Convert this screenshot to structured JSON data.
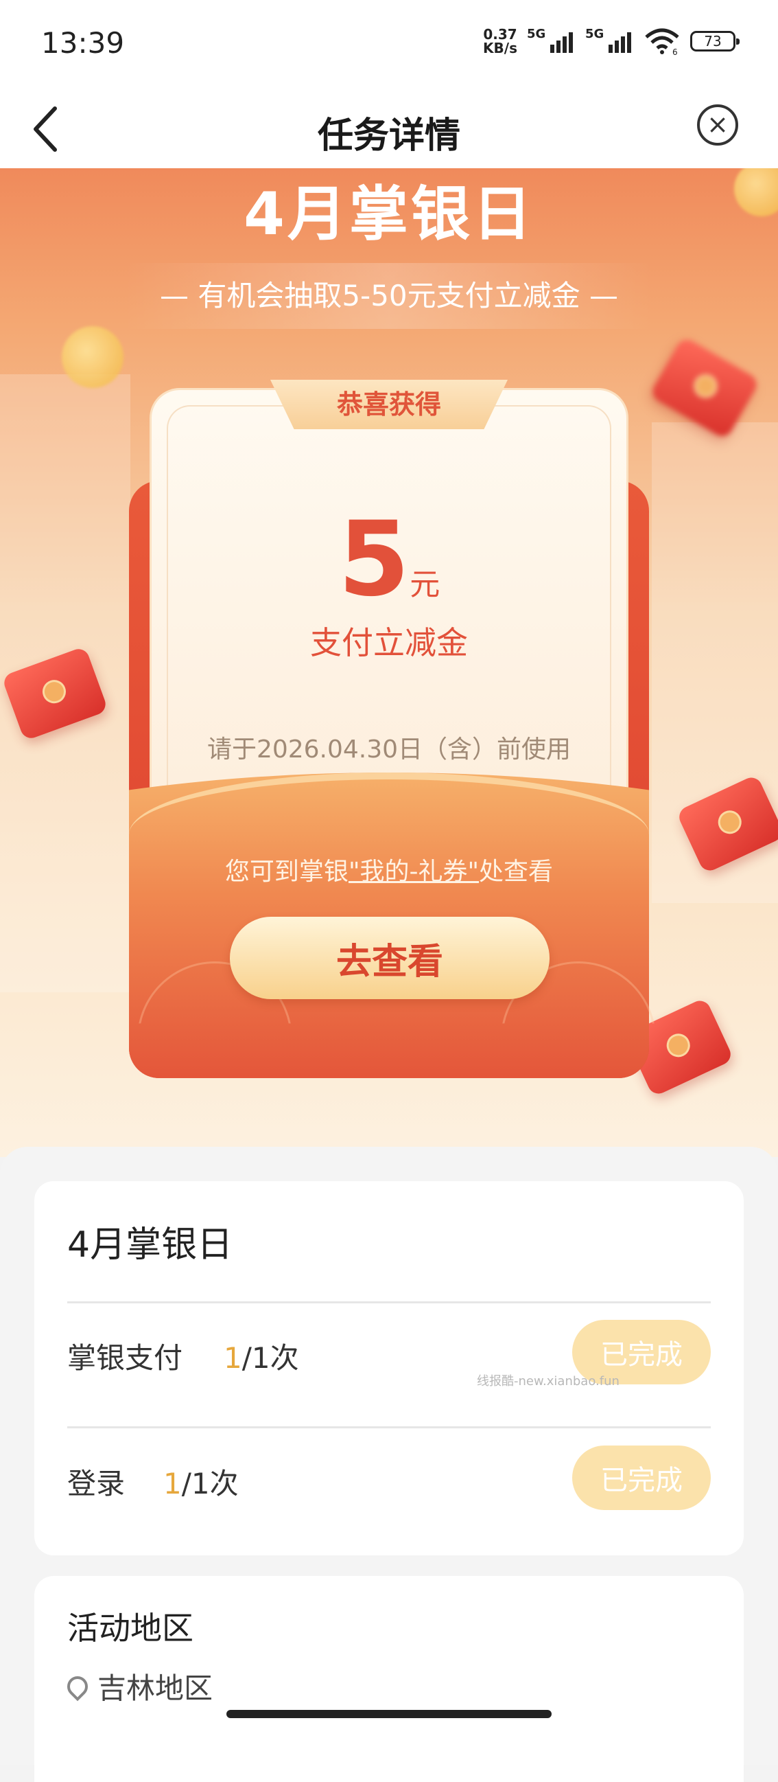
{
  "status_bar": {
    "time": "13:39",
    "net_speed_value": "0.37",
    "net_speed_unit": "KB/s",
    "signal1": "5G",
    "signal2": "5G",
    "wifi_label": "6",
    "battery": "73"
  },
  "nav": {
    "back_icon": "chevron-left-icon",
    "title": "任务详情",
    "close_icon": "close-circle-icon"
  },
  "banner": {
    "title": "4月掌银日",
    "subtitle": "— 有机会抽取5-50元支付立减金 —"
  },
  "prize": {
    "ribbon": "恭喜获得",
    "amount": "5",
    "unit": "元",
    "name": "支付立减金",
    "expire": "请于2026.04.30日（含）前使用",
    "note_prefix": "您可到掌银",
    "note_link": "\"我的-礼券\"",
    "note_suffix": "处查看",
    "button": "去查看"
  },
  "task": {
    "title": "4月掌银日",
    "rows": [
      {
        "name": "掌银支付",
        "current": "1",
        "total": "/1次",
        "status": "已完成"
      },
      {
        "name": "登录",
        "current": "1",
        "total": "/1次",
        "status": "已完成"
      }
    ]
  },
  "area": {
    "title": "活动地区",
    "location": "吉林地区",
    "location_icon": "location-pin-icon"
  },
  "watermark": "线报酷-new.xianbao.fun"
}
